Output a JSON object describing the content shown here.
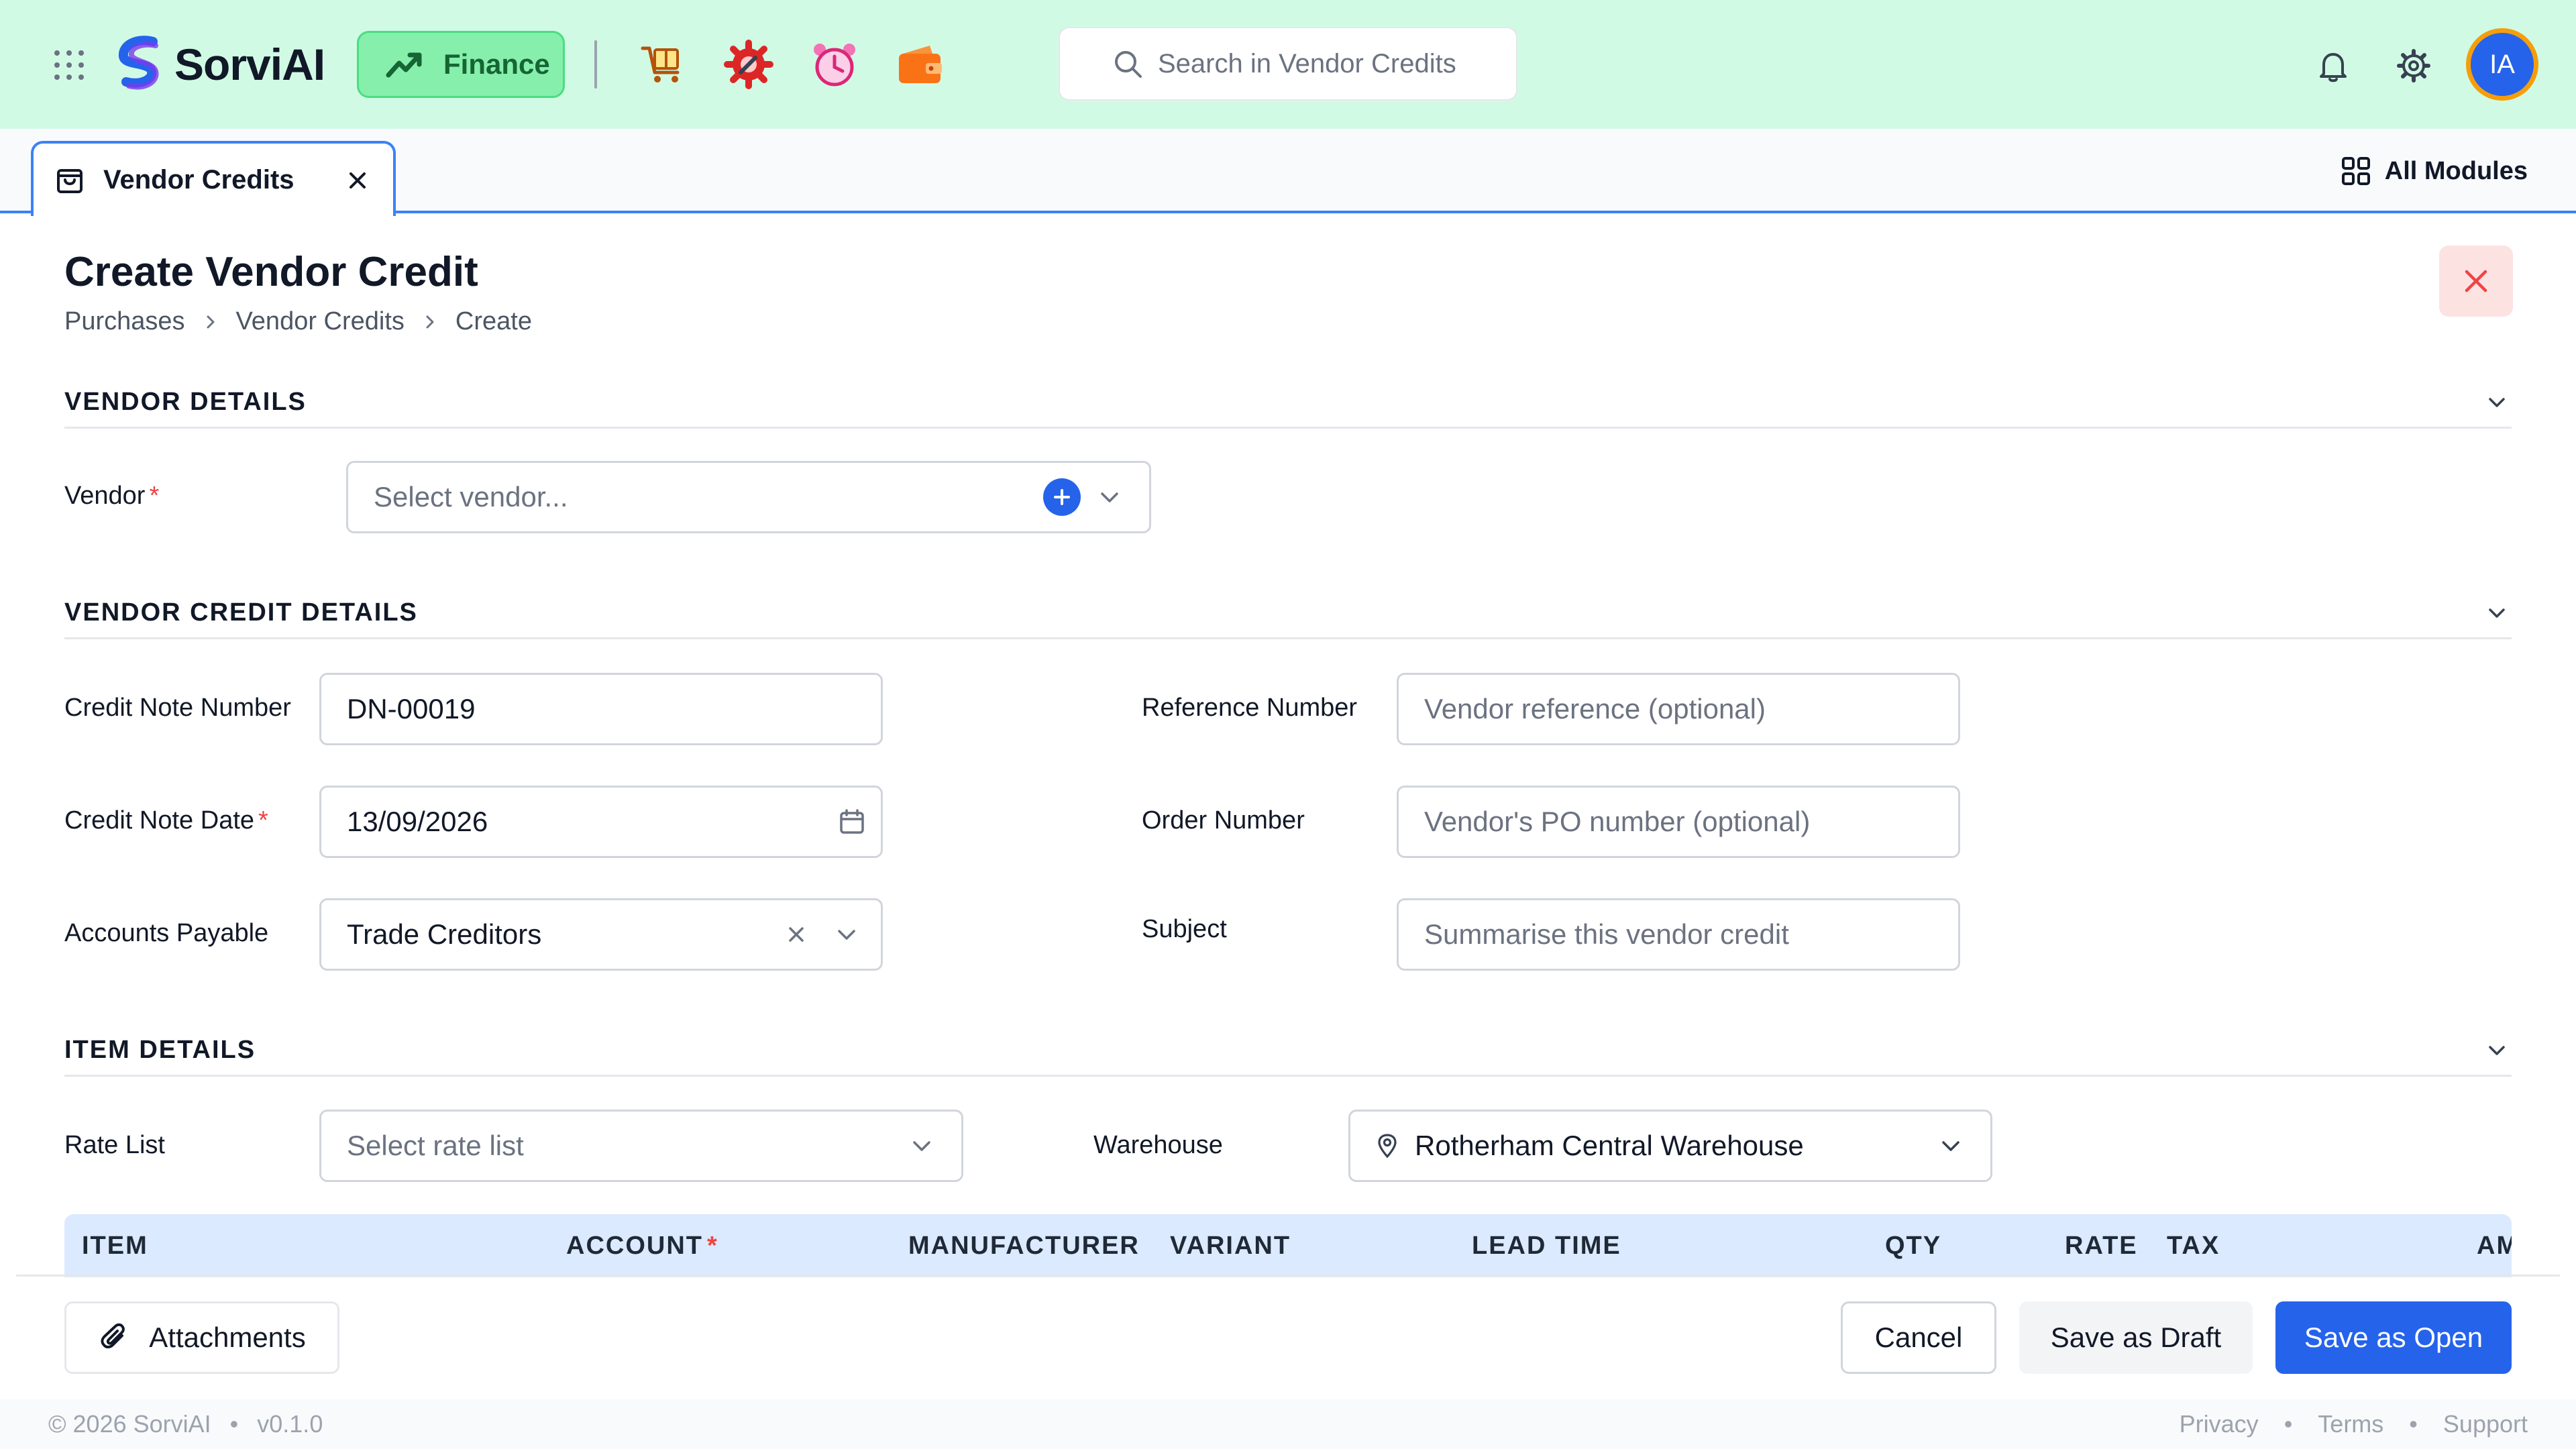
{
  "app": {
    "name": "SorviAI",
    "module_label": "Finance",
    "search_placeholder": "Search in Vendor Credits",
    "user_initials": "IA",
    "icons": [
      "grid-icon",
      "shopping-box-icon",
      "gear-wrench-icon",
      "alarm-clock-icon",
      "wallet-icon",
      "bell-icon",
      "settings-gear-icon"
    ]
  },
  "tabs": {
    "active_label": "Vendor Credits",
    "all_modules_label": "All Modules"
  },
  "page": {
    "title": "Create Vendor Credit",
    "breadcrumb": [
      "Purchases",
      "Vendor Credits",
      "Create"
    ]
  },
  "vendor_details": {
    "section_title": "VENDOR DETAILS",
    "vendor_label": "Vendor",
    "required_mark": "*",
    "vendor_placeholder": "Select vendor..."
  },
  "credit_details": {
    "section_title": "VENDOR CREDIT DETAILS",
    "credit_note_number_label": "Credit Note Number",
    "credit_note_number_value": "DN-00019",
    "credit_note_date_label": "Credit Note Date",
    "credit_note_date_value": "13/09/2026",
    "accounts_payable_label": "Accounts Payable",
    "accounts_payable_value": "Trade Creditors",
    "reference_number_label": "Reference Number",
    "reference_number_placeholder": "Vendor reference (optional)",
    "order_number_label": "Order Number",
    "order_number_placeholder": "Vendor's PO number (optional)",
    "subject_label": "Subject",
    "subject_placeholder": "Summarise this vendor credit"
  },
  "item_details": {
    "section_title": "ITEM DETAILS",
    "rate_list_label": "Rate List",
    "rate_list_placeholder": "Select rate list",
    "warehouse_label": "Warehouse",
    "warehouse_value": "Rotherham Central Warehouse",
    "columns": [
      "ITEM",
      "ACCOUNT",
      "MANUFACTURER",
      "VARIANT",
      "LEAD TIME",
      "QTY",
      "RATE",
      "TAX",
      "AM"
    ]
  },
  "actions": {
    "attachments": "Attachments",
    "cancel": "Cancel",
    "save_draft": "Save as Draft",
    "save_open": "Save as Open"
  },
  "footer": {
    "copyright": "© 2026 SorviAI",
    "separator": "•",
    "version": "v0.1.0",
    "links": [
      "Privacy",
      "Terms",
      "Support"
    ]
  },
  "colors": {
    "topbar_bg": "#d1fae5",
    "module_green": "#86efac",
    "primary_blue": "#2563eb",
    "table_head_bg": "#dbeafe",
    "danger_bg": "#fde2e2",
    "danger": "#ef4444"
  }
}
